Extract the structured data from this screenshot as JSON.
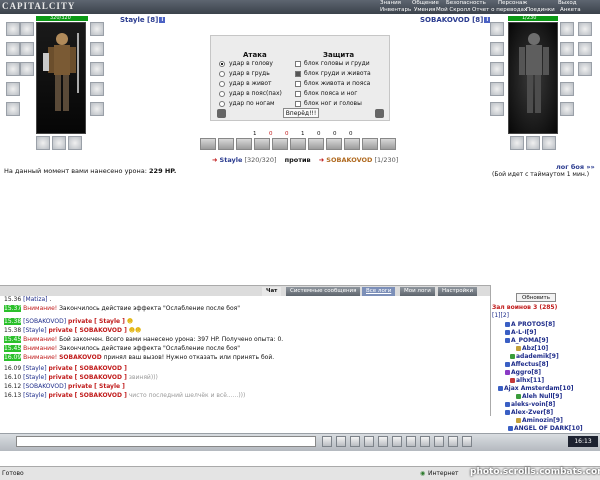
{
  "app": {
    "logo": "CAPITALCITY"
  },
  "menu_top": [
    "Знания",
    "Общение",
    "Безопасность",
    "Персонаж",
    "Выход"
  ],
  "menu_bottom": [
    "Инвентарь",
    "Умения",
    "Мой Скролл",
    "Отчет о переводах",
    "Поединки",
    "Анкета"
  ],
  "left_player": {
    "name": "Stayle [8]",
    "hp": "320/320"
  },
  "right_player": {
    "name": "SOBAKOVOD [8]",
    "hp": "1/230"
  },
  "battle": {
    "attack_title": "Атака",
    "defense_title": "Защита",
    "attacks": [
      "удар в голову",
      "удар в грудь",
      "удар в живот",
      "удар в пояс(пах)",
      "удар по ногам"
    ],
    "defenses": [
      "блок головы и груди",
      "блок груди и живота",
      "блок живота и пояса",
      "блок пояса и ног",
      "блок ног и головы"
    ],
    "go_label": "Вперёд!!!"
  },
  "stats": [
    "1",
    "0",
    "0",
    "1",
    "0",
    "0",
    "0"
  ],
  "versus": {
    "left": "Stayle",
    "left_hp": "[320/320]",
    "word": "против",
    "right": "SOBAKOVOD",
    "right_hp": "[1/230]"
  },
  "damage_text": {
    "prefix": "На данный момент вами нанесено урона:",
    "value": "229 HP."
  },
  "log_link": "лог боя »»",
  "timeout_text": "(Бой идет с таймаутом 1 мин.)",
  "tabs": [
    "Чат",
    "Системные сообщения",
    "Все логи",
    "Мои логи",
    "Настройки"
  ],
  "chat": [
    {
      "time": "15.36",
      "pre": "",
      "a": "[Matiza]",
      "b": "",
      "c": "",
      "rest": " ."
    },
    {
      "time": "15.37",
      "pre": "Внимание!",
      "a": "",
      "b": "",
      "c": "",
      "rest": " Закончилось действие эффекта \"Ослабление после боя\""
    },
    {
      "time": "15.38",
      "pre": "",
      "a": "[SOBAKOVOD]",
      "b": "private",
      "c": "[ Stayle ]",
      "rest": ""
    },
    {
      "time": "15.38",
      "pre": "",
      "a": "[Stayle]",
      "b": "private",
      "c": "[ SOBAKOVOD ]",
      "rest": ""
    },
    {
      "time": "15.45",
      "pre": "Внимание!",
      "a": "",
      "b": "",
      "c": "",
      "rest": " Бой закончен. Всего вами нанесено урона: 397 HP. Получено опыта: 0."
    },
    {
      "time": "15.45",
      "pre": "Внимание!",
      "a": "",
      "b": "",
      "c": "",
      "rest": " Закончилось действие эффекта \"Ослабление после боя\""
    },
    {
      "time": "16.09",
      "pre": "Внимание!",
      "a": "SOBAKOVOD",
      "b": "",
      "c": "",
      "rest": " принял ваш вызов! Нужно отказать или принять бой."
    },
    {
      "time": "16.09",
      "pre": "",
      "a": "[Stayle]",
      "b": "private",
      "c": "[ SOBAKOVOD ]",
      "rest": ""
    },
    {
      "time": "16.10",
      "pre": "",
      "a": "[Stayle]",
      "b": "private",
      "c": "[ SOBAKOVOD ]",
      "rest": " звиняй)))"
    },
    {
      "time": "16.12",
      "pre": "",
      "a": "[SOBAKOVOD]",
      "b": "private",
      "c": "[ Stayle ]",
      "rest": ""
    },
    {
      "time": "16.13",
      "pre": "",
      "a": "[Stayle]",
      "b": "private",
      "c": "[ SOBAKOVOD ]",
      "rest": " чисто последний шелчёк и всё......)))"
    }
  ],
  "room": {
    "refresh": "Обновить",
    "title": "Зал воинов 3 (285)",
    "pages": "[1][2]",
    "users": [
      "A PROTOS[8]",
      "A-L-I[9]",
      "A_POMA[9]",
      "Abz[10]",
      "adademik[9]",
      "Affectus[8]",
      "Aggro[8]",
      "alhx[11]",
      "Ajax Amsterdam[10]",
      "Aleh Null[9]",
      "aleks-voin[8]",
      "Alex-Zver[8]",
      "Aminozin[9]",
      "ANGEL OF DARK[10]"
    ]
  },
  "status": {
    "ready": "Готово",
    "internet": "Интернет",
    "watermark": "photo.scrolls.combats.com",
    "clock": "16:13"
  },
  "colors": {
    "hp_green": "#0c9a16",
    "name_blue": "#2a3b8f",
    "warn_red": "#c01a1a"
  }
}
